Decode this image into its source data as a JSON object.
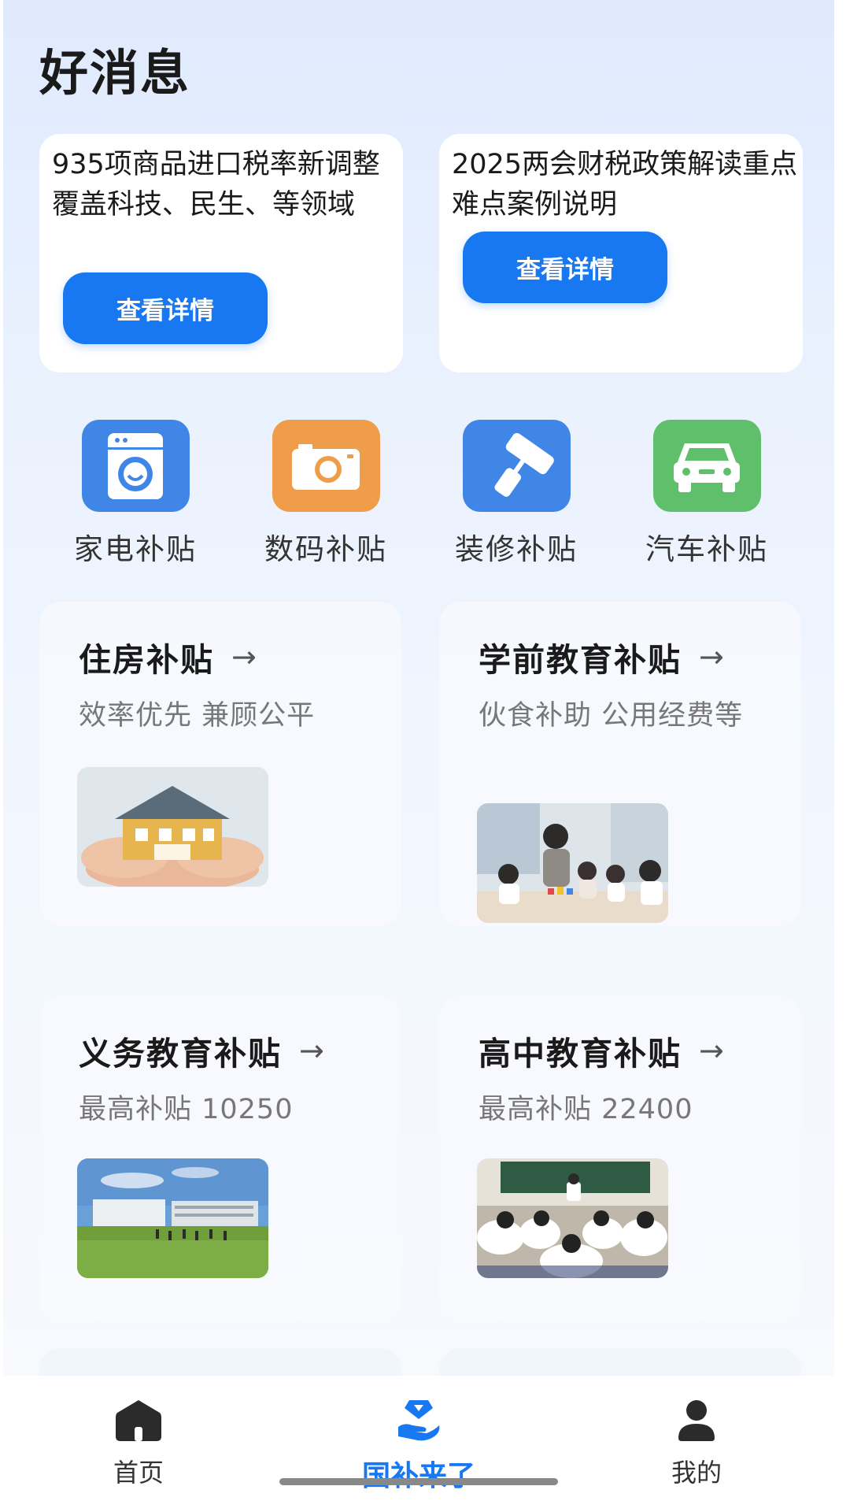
{
  "page": {
    "title": "好消息"
  },
  "news": [
    {
      "text": "935项商品进口税率新调整 覆盖科技、民生、等领域",
      "button": "查看详情"
    },
    {
      "text": "2025两会财税政策解读重点难点案例说明",
      "button": "查看详情"
    }
  ],
  "categories": [
    {
      "label": "家电补贴",
      "icon": "washing-machine-icon",
      "color": "#3f86e6"
    },
    {
      "label": "数码补贴",
      "icon": "camera-icon",
      "color": "#ef9d4a"
    },
    {
      "label": "装修补贴",
      "icon": "paint-roller-icon",
      "color": "#3f86e6"
    },
    {
      "label": "汽车补贴",
      "icon": "car-icon",
      "color": "#5fbf6a"
    }
  ],
  "subsidies": [
    {
      "title": "住房补贴",
      "desc": "效率优先 兼顾公平",
      "image": "house-in-hands"
    },
    {
      "title": "学前教育补贴",
      "desc": "伙食补助 公用经费等",
      "image": "kindergarten-class"
    },
    {
      "title": "义务教育补贴",
      "desc": "最高补贴 10250",
      "image": "school-campus"
    },
    {
      "title": "高中教育补贴",
      "desc": "最高补贴 22400",
      "image": "high-school-classroom"
    }
  ],
  "arrow": "→",
  "tabs": [
    {
      "label": "首页",
      "icon": "home-icon"
    },
    {
      "label": "国补来了",
      "icon": "subsidy-hand-icon"
    },
    {
      "label": "我的",
      "icon": "user-icon"
    }
  ],
  "colors": {
    "primary": "#1778f2",
    "green": "#5fbf6a",
    "orange": "#ef9d4a"
  }
}
